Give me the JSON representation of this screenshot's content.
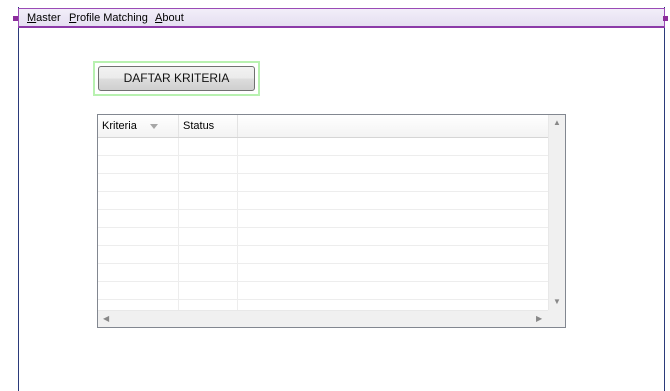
{
  "menu": {
    "items": [
      {
        "mnemonic": "M",
        "rest": "aster"
      },
      {
        "mnemonic": "P",
        "rest": "rofile Matching"
      },
      {
        "mnemonic": "A",
        "rest": "bout"
      }
    ]
  },
  "main": {
    "button_label": "DAFTAR KRITERIA"
  },
  "grid": {
    "columns": [
      "Kriteria",
      "Status"
    ],
    "rows": [
      [
        "",
        ""
      ],
      [
        "",
        ""
      ],
      [
        "",
        ""
      ],
      [
        "",
        ""
      ],
      [
        "",
        ""
      ],
      [
        "",
        ""
      ],
      [
        "",
        ""
      ],
      [
        "",
        ""
      ],
      [
        "",
        ""
      ],
      [
        "",
        ""
      ]
    ]
  },
  "colors": {
    "menubar_border": "#8c3aa8",
    "selection_handles": "#8c2c9c",
    "button_focus_border": "#b8f1b0",
    "window_border": "#2b3a7a"
  },
  "icons": {
    "sort": "sort-arrow-icon",
    "scroll_up": "scroll-up-icon",
    "scroll_down": "scroll-down-icon",
    "scroll_left": "scroll-left-icon",
    "scroll_right": "scroll-right-icon"
  }
}
